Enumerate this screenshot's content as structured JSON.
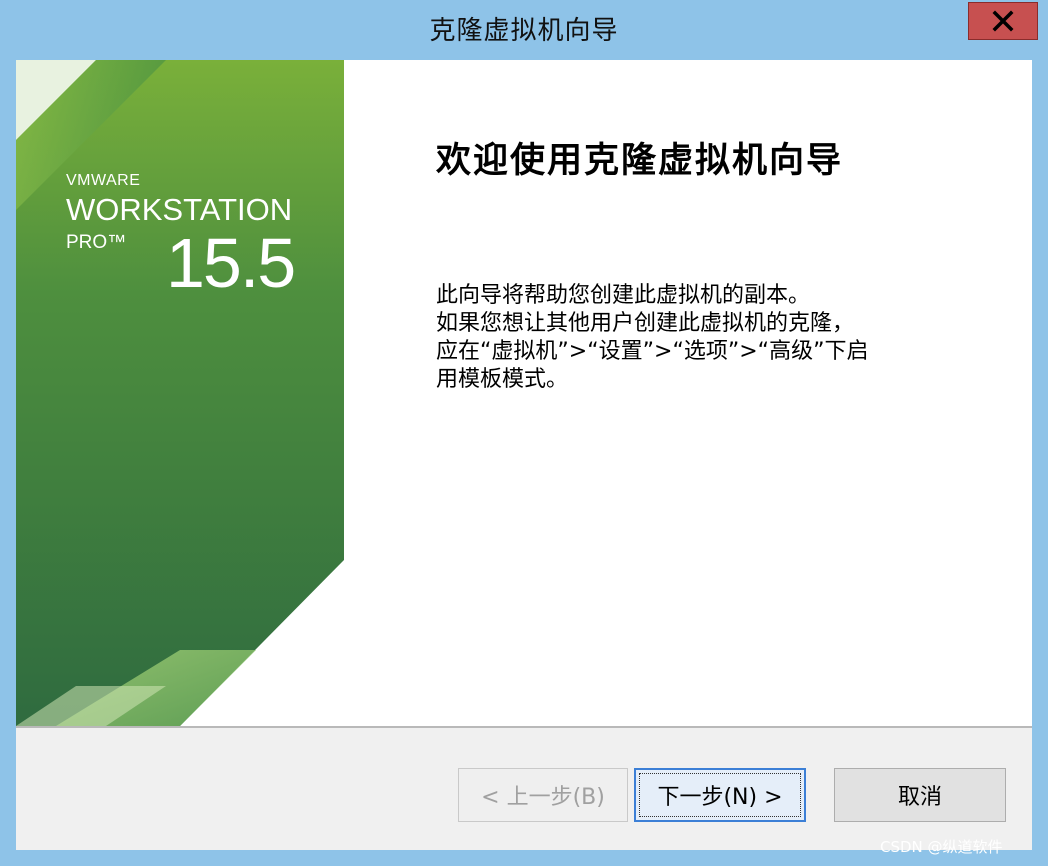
{
  "window": {
    "title": "克隆虚拟机向导",
    "close_label": "X"
  },
  "banner": {
    "vmware": "VMWARE",
    "workstation": "WORKSTATION",
    "pro": "PRO™",
    "version": "15.5"
  },
  "content": {
    "heading": "欢迎使用克隆虚拟机向导",
    "lines": [
      "此向导将帮助您创建此虚拟机的副本。",
      "如果您想让其他用户创建此虚拟机的克隆，",
      "应在“虚拟机”>“设置”>“选项”>“高级”下启",
      "用模板模式。"
    ]
  },
  "buttons": {
    "back": "< 上一步(B)",
    "next": "下一步(N) >",
    "cancel": "取消"
  },
  "watermark": "CSDN @纵道软件",
  "colors": {
    "titlebar": "#8ec3e8",
    "close": "#c75050",
    "banner_green": "#3f7d46"
  }
}
